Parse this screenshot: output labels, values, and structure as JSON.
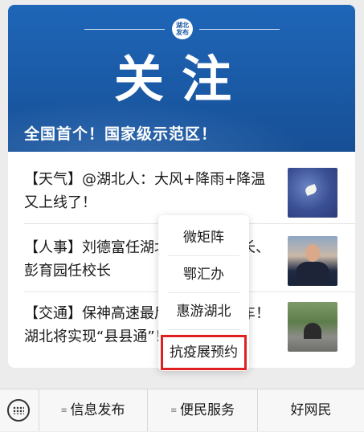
{
  "banner": {
    "logo_text": "湖北\n发布",
    "title": "关注",
    "subtitle": "全国首个！国家级示范区！"
  },
  "news": [
    {
      "text": "【天气】@湖北人：大风+降雨+降温又上线了！",
      "thumb": "weather-thumbnail"
    },
    {
      "text": "【人事】刘德富任湖北工业大学校长、彭育园任校长",
      "thumb": "person-thumbnail"
    },
    {
      "text": "【交通】保神高速最后一段即将通车！湖北将实现“县县通”！",
      "thumb": "tunnel-thumbnail"
    }
  ],
  "popup_menu": {
    "items": [
      "微矩阵",
      "鄂汇办",
      "惠游湖北",
      "抗疫展预约"
    ],
    "highlighted_index": 3,
    "highlight_color": "#e02020"
  },
  "bottom_bar": {
    "keyboard_icon": "keyboard-icon",
    "tabs": [
      {
        "label": "信息发布",
        "has_menu_glyph": true
      },
      {
        "label": "便民服务",
        "has_menu_glyph": true
      },
      {
        "label": "好网民",
        "has_menu_glyph": false
      }
    ]
  },
  "colors": {
    "banner_blue": "#1a5aa6",
    "page_bg": "#ececec"
  }
}
